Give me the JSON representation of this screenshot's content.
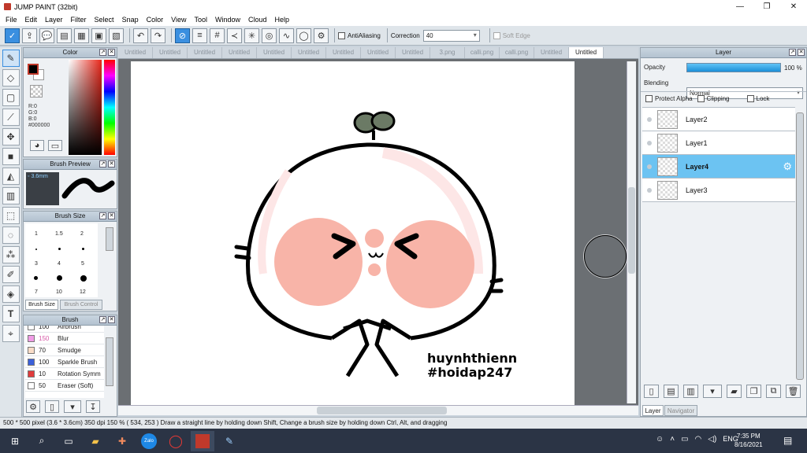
{
  "window": {
    "title": "JUMP PAINT (32bit)"
  },
  "menu": [
    "File",
    "Edit",
    "Layer",
    "Filter",
    "Select",
    "Snap",
    "Color",
    "View",
    "Tool",
    "Window",
    "Cloud",
    "Help"
  ],
  "toolbar": {
    "antialiasing_label": "AntiAliasing",
    "correction_label": "Correction",
    "correction_value": "40",
    "soft_edge_label": "Soft Edge"
  },
  "color_panel": {
    "title": "Color",
    "r": "R:0",
    "g": "G:0",
    "b": "B:0",
    "hex": "#000000",
    "fg_color": "#000000",
    "bg_color": "#ffffff"
  },
  "brush_preview": {
    "title": "Brush Preview",
    "size": "3.6mm"
  },
  "brush_size": {
    "title": "Brush Size",
    "values": [
      "1",
      "1.5",
      "2",
      "3",
      "4",
      "5",
      "7",
      "10",
      "12"
    ],
    "tab_active": "Brush Size",
    "tab_inactive": "Brush Control"
  },
  "brush_list": {
    "title": "Brush",
    "items": [
      {
        "size": "100",
        "name": "Airbrush",
        "color": "#ffffff"
      },
      {
        "size": "150",
        "name": "Blur",
        "color": "#f19ce6"
      },
      {
        "size": "70",
        "name": "Smudge",
        "color": "#f9ddc8"
      },
      {
        "size": "100",
        "name": "Sparkle Brush",
        "color": "#3a5fd9"
      },
      {
        "size": "10",
        "name": "Rotation Symm",
        "color": "#e03c3c"
      },
      {
        "size": "50",
        "name": "Eraser (Soft)",
        "color": "#ffffff"
      }
    ]
  },
  "tabs": [
    "Untitled",
    "Untitled",
    "Untitled",
    "Untitled",
    "Untitled",
    "Untitled",
    "Untitled",
    "Untitled",
    "Untitled",
    "3.png",
    "calli.png",
    "calli.png",
    "Untitled",
    "Untitled"
  ],
  "artwork": {
    "line1": "huynhthienn",
    "line2": "#hoidap247"
  },
  "layer_panel": {
    "title": "Layer",
    "opacity_label": "Opacity",
    "opacity_value": "100 %",
    "opacity_fraction": 1.0,
    "blending_label": "Blending",
    "blending_value": "Normal",
    "protect_alpha": "Protect Alpha",
    "clipping": "Clipping",
    "lock": "Lock",
    "layers": [
      {
        "name": "Layer2",
        "selected": false
      },
      {
        "name": "Layer1",
        "selected": false
      },
      {
        "name": "Layer4",
        "selected": true
      },
      {
        "name": "Layer3",
        "selected": false
      }
    ],
    "tab_active": "Layer",
    "tab_inactive": "Navigator"
  },
  "status": {
    "text": "500 * 500 pixel   (3.6 * 3.6cm)   350 dpi   150 %   ( 534, 253 )   Draw a straight line by holding down Shift, Change a brush size by holding down Ctrl, Alt, and dragging"
  },
  "taskbar": {
    "lang": "ENG",
    "time": "7:35 PM",
    "date": "8/16/2021"
  }
}
